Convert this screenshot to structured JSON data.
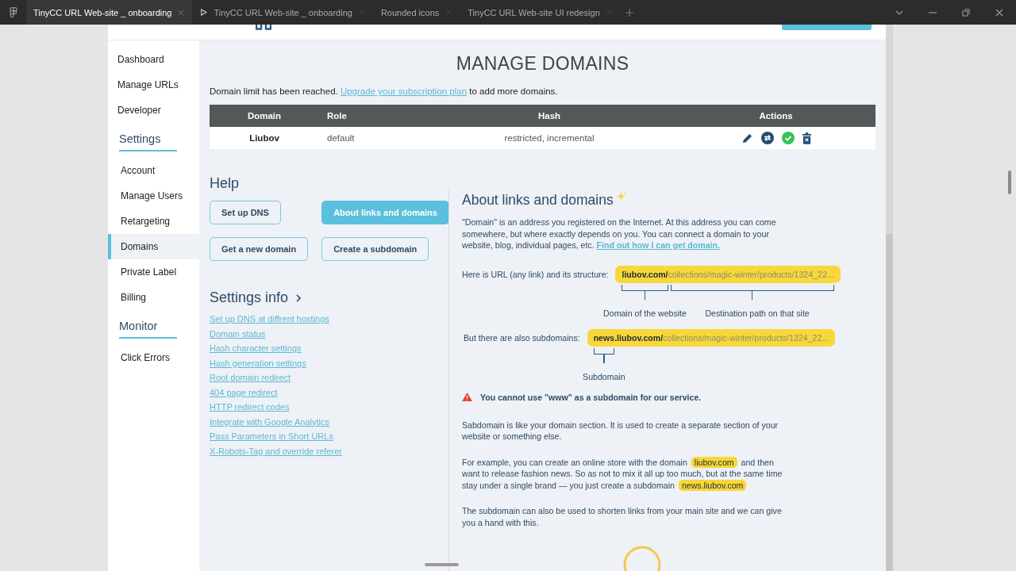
{
  "app_tabs": [
    {
      "label": "TinyCC URL Web-site _ onboarding",
      "selected": true,
      "kind": "file"
    },
    {
      "label": "TinyCC URL Web-site _ onboarding",
      "selected": false,
      "kind": "prototype"
    },
    {
      "label": "Rounded icons",
      "selected": false,
      "kind": "file"
    },
    {
      "label": "TinyCC URL Web-site UI redesign",
      "selected": false,
      "kind": "file"
    }
  ],
  "sidebar": {
    "groups": [
      {
        "items": [
          {
            "label": "Dashboard",
            "selected": false
          },
          {
            "label": "Manage URLs",
            "selected": false
          },
          {
            "label": "Developer",
            "selected": false
          }
        ]
      },
      {
        "title": "Settings",
        "items": [
          {
            "label": "Account",
            "selected": false
          },
          {
            "label": "Manage Users",
            "selected": false
          },
          {
            "label": "Retargeting",
            "selected": false
          },
          {
            "label": "Domains",
            "selected": true
          },
          {
            "label": "Private Label",
            "selected": false
          },
          {
            "label": "Billing",
            "selected": false
          }
        ]
      },
      {
        "title": "Monitor",
        "items": [
          {
            "label": "Click Errors",
            "selected": false
          }
        ]
      }
    ]
  },
  "page": {
    "title": "MANAGE DOMAINS",
    "notice": {
      "text": "Domain limit has been reached.",
      "link": "Upgrade your subscription plan",
      "text_after": "to add more domains."
    },
    "table": {
      "columns": [
        "Domain",
        "Role",
        "Hash",
        "Actions"
      ],
      "rows": [
        {
          "domain": "Liubov",
          "role": "default",
          "hash": "restricted, incremental",
          "actions": [
            {
              "kind": "edit"
            },
            {
              "kind": "swap"
            },
            {
              "kind": "verify"
            },
            {
              "kind": "delete"
            }
          ]
        }
      ]
    },
    "help": {
      "title": "Help",
      "buttons": [
        {
          "label": "Set up DNS",
          "selected": false
        },
        {
          "label": "About links and domains",
          "selected": true
        },
        {
          "label": "Get a new domain",
          "selected": false
        },
        {
          "label": "Create a subdomain",
          "selected": false
        }
      ]
    },
    "settings_info": {
      "title": "Settings info",
      "links": [
        "Set up DNS at diffrent hostings",
        "Domain status",
        "Hash character settings",
        "Hash generation settings",
        "Root domain redirect",
        "404 page redirect",
        "HTTP redirect codes",
        "Integrate with Google Analytics",
        "Pass Parameters in Short URLs",
        "X-Robots-Tag and override referer"
      ]
    },
    "about": {
      "title": "About links and domains",
      "intro": {
        "text": "\"Domain\" is an address you registered on the Internet. At this address you can come somewhere, but where exactly depends on you. You can connect a domain to your website, blog, individual pages, etc.",
        "link": "Find out how I can get domain."
      },
      "url_example": {
        "label": "Here is URL (any link) and its structure:",
        "domain": "liubov.com/",
        "path": "collections/magic-winter/products/1324_22...",
        "domain_caption": "Domain of the website",
        "path_caption": "Destination path on that site"
      },
      "subdomain_example": {
        "label": "But there are also subdomains:",
        "subdomain": "news",
        "domain": ".liubov.com/",
        "path": "collections/magic-winter/products/1324_22...",
        "caption": "Subdomain"
      },
      "warning": "You cannot use \"www\" as a subdomain for our service.",
      "paragraphs": [
        [
          {
            "text": "Sabdomain is like your domain section. It is used to create a separate section of your website or something else.",
            "highlight": false
          }
        ],
        [
          {
            "text": "For example, you can create an online store with the domain ",
            "highlight": false
          },
          {
            "text": "liubov.com",
            "highlight": true
          },
          {
            "text": " and then want to release fashion news. So as not to mix it all up too much, but at the same time stay under a single brand — you just create a subdomain ",
            "highlight": false
          },
          {
            "text": "news.liubov.com",
            "highlight": true
          }
        ],
        [
          {
            "text": "The subdomain can also be used to shorten links from your main site and we can give you a hand with this.",
            "highlight": false
          }
        ]
      ]
    }
  }
}
